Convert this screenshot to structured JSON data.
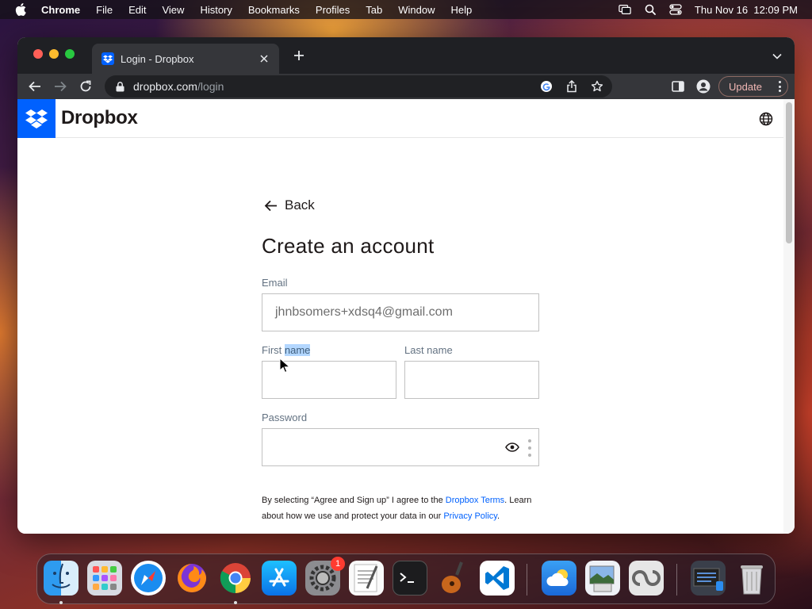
{
  "menubar": {
    "app": "Chrome",
    "items": [
      "File",
      "Edit",
      "View",
      "History",
      "Bookmarks",
      "Profiles",
      "Tab",
      "Window",
      "Help"
    ],
    "clock": "Thu Nov 16  12:09 PM"
  },
  "browser": {
    "tab_title": "Login - Dropbox",
    "url_host": "dropbox.com",
    "url_path": "/login",
    "update_label": "Update"
  },
  "site": {
    "brand": "Dropbox",
    "back_label": "Back",
    "title": "Create an account",
    "email_label": "Email",
    "email_value": "jhnbsomers+xdsq4@gmail.com",
    "first_name_label_a": "First ",
    "first_name_label_b": "name",
    "last_name_label": "Last name",
    "password_label": "Password",
    "legal_1": "By selecting “Agree and Sign up” I agree to the ",
    "legal_terms_link": "Dropbox Terms",
    "legal_2": ". Learn about how we use and protect your data in our ",
    "legal_privacy_link": "Privacy Policy",
    "legal_3": "."
  },
  "dock": {
    "apps": [
      "Finder",
      "Launchpad",
      "Safari",
      "Firefox",
      "Chrome",
      "App Store",
      "System Settings",
      "TextEdit",
      "Terminal",
      "GarageBand",
      "Visual Studio Code",
      "Weather",
      "Preview",
      "Creative Cloud",
      "Downloads",
      "Trash"
    ],
    "settings_badge": "1"
  },
  "colors": {
    "dropbox_blue": "#0061fe",
    "chrome_tab_bg": "#35363a",
    "chrome_frame": "#1f2024"
  }
}
